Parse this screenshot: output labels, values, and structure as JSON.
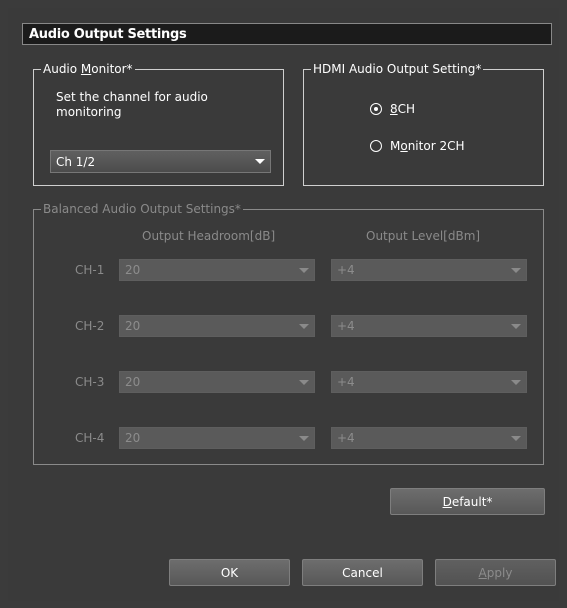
{
  "dialog": {
    "title": "Audio Output Settings"
  },
  "audio_monitor": {
    "legend_pre": "Audio ",
    "legend_accel": "M",
    "legend_post": "onitor*",
    "description": "Set the channel for audio monitoring",
    "selected": "Ch 1/2"
  },
  "hdmi": {
    "legend": "HDMI Audio Output Setting*",
    "options": [
      {
        "accel": "8",
        "rest": "CH",
        "selected": true
      },
      {
        "pre": "M",
        "accel": "o",
        "rest": "nitor 2CH",
        "selected": false
      }
    ]
  },
  "balanced": {
    "legend": "Balanced Audio Output Settings*",
    "col_headroom": "Output Headroom[dB]",
    "col_level": "Output Level[dBm]",
    "rows": [
      {
        "label": "CH-1",
        "headroom": "20",
        "level": "+4"
      },
      {
        "label": "CH-2",
        "headroom": "20",
        "level": "+4"
      },
      {
        "label": "CH-3",
        "headroom": "20",
        "level": "+4"
      },
      {
        "label": "CH-4",
        "headroom": "20",
        "level": "+4"
      }
    ]
  },
  "buttons": {
    "default_accel": "D",
    "default_rest": "efault*",
    "ok": "OK",
    "cancel": "Cancel",
    "apply_accel": "A",
    "apply_rest": "pply"
  }
}
